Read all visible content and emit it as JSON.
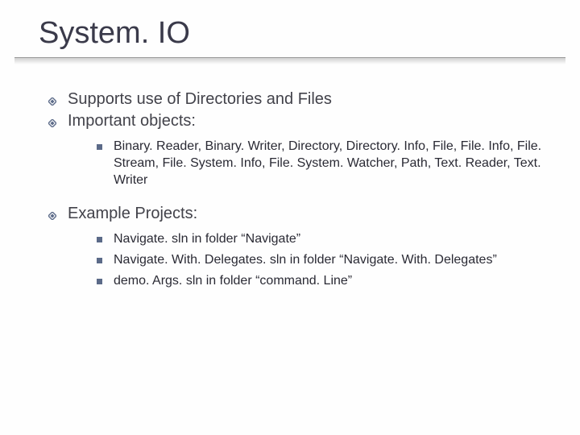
{
  "title": "System. IO",
  "bullets_top": [
    "Supports use of Directories and Files",
    "Important objects:"
  ],
  "sub_objects": [
    "Binary. Reader, Binary. Writer, Directory, Directory. Info, File, File. Info, File. Stream, File. System. Info, File. System. Watcher, Path, Text. Reader, Text. Writer"
  ],
  "bullets_mid": [
    "Example Projects:"
  ],
  "sub_projects": [
    "Navigate. sln in folder “Navigate”",
    "Navigate. With. Delegates. sln in folder “Navigate. With. Delegates”",
    "demo. Args. sln in folder “command. Line”"
  ]
}
